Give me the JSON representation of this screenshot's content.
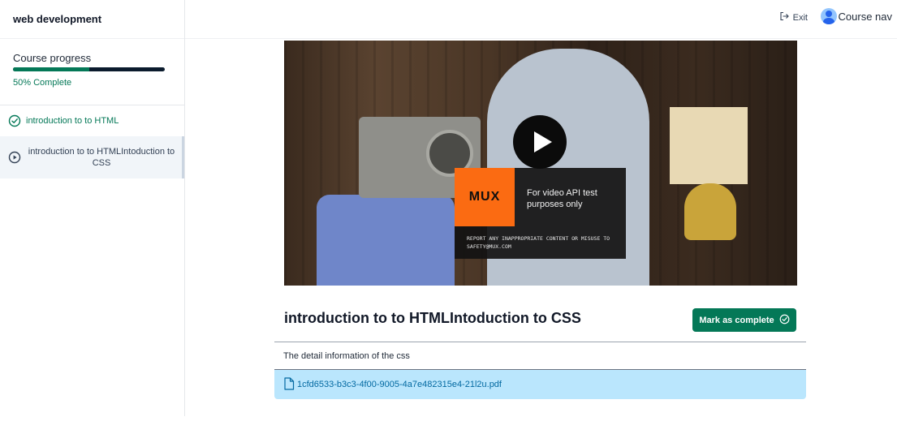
{
  "sidebar": {
    "course_title": "web development",
    "progress_label": "Course progress",
    "progress_percent": 50,
    "progress_text": "50% Complete",
    "chapters": [
      {
        "label": "introduction to to HTML",
        "state": "completed",
        "icon": "check-circle-icon"
      },
      {
        "label": "introduction to to HTMLIntoduction to CSS",
        "state": "active",
        "icon": "play-circle-icon"
      }
    ]
  },
  "header": {
    "exit_label": "Exit",
    "exit_icon": "logout-icon",
    "course_nav_label": "Course nav"
  },
  "video": {
    "overlay_brand": "MUX",
    "overlay_message": "For video API test purposes only",
    "overlay_report": "REPORT ANY INAPPROPRIATE CONTENT OR MISUSE TO SAFETY@MUX.COM"
  },
  "lesson": {
    "title": "introduction to to HTMLIntoduction to CSS",
    "complete_button_label": "Mark as complete",
    "description": "The detail information of the css",
    "attachment_name": "1cfd6533-b3c3-4f00-9005-4a7e482315e4-21l2u.pdf"
  },
  "colors": {
    "accent": "#047857",
    "attachment_bg": "#bae6fd",
    "mux_orange": "#fb6b12"
  }
}
